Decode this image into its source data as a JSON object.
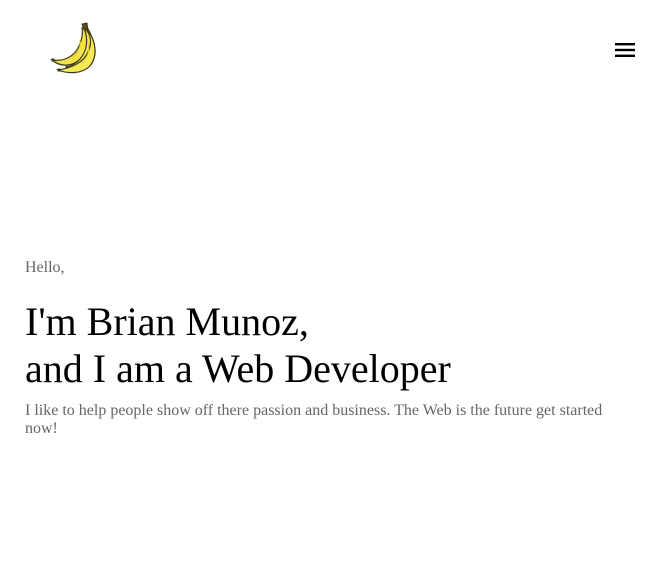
{
  "header": {
    "logo_icon": "banana-icon",
    "menu_icon": "hamburger-menu-icon"
  },
  "hero": {
    "greeting": "Hello,",
    "headline_line1": "I'm Brian Munoz,",
    "headline_line2": "and I am a Web Developer",
    "tagline": "I like to help people show off there passion and business. The Web is the future get started now!"
  },
  "colors": {
    "background": "#ffffff",
    "headline": "#000000",
    "muted_text": "#666666",
    "banana_yellow": "#f2e24a",
    "banana_outline": "#3a3a1a"
  }
}
